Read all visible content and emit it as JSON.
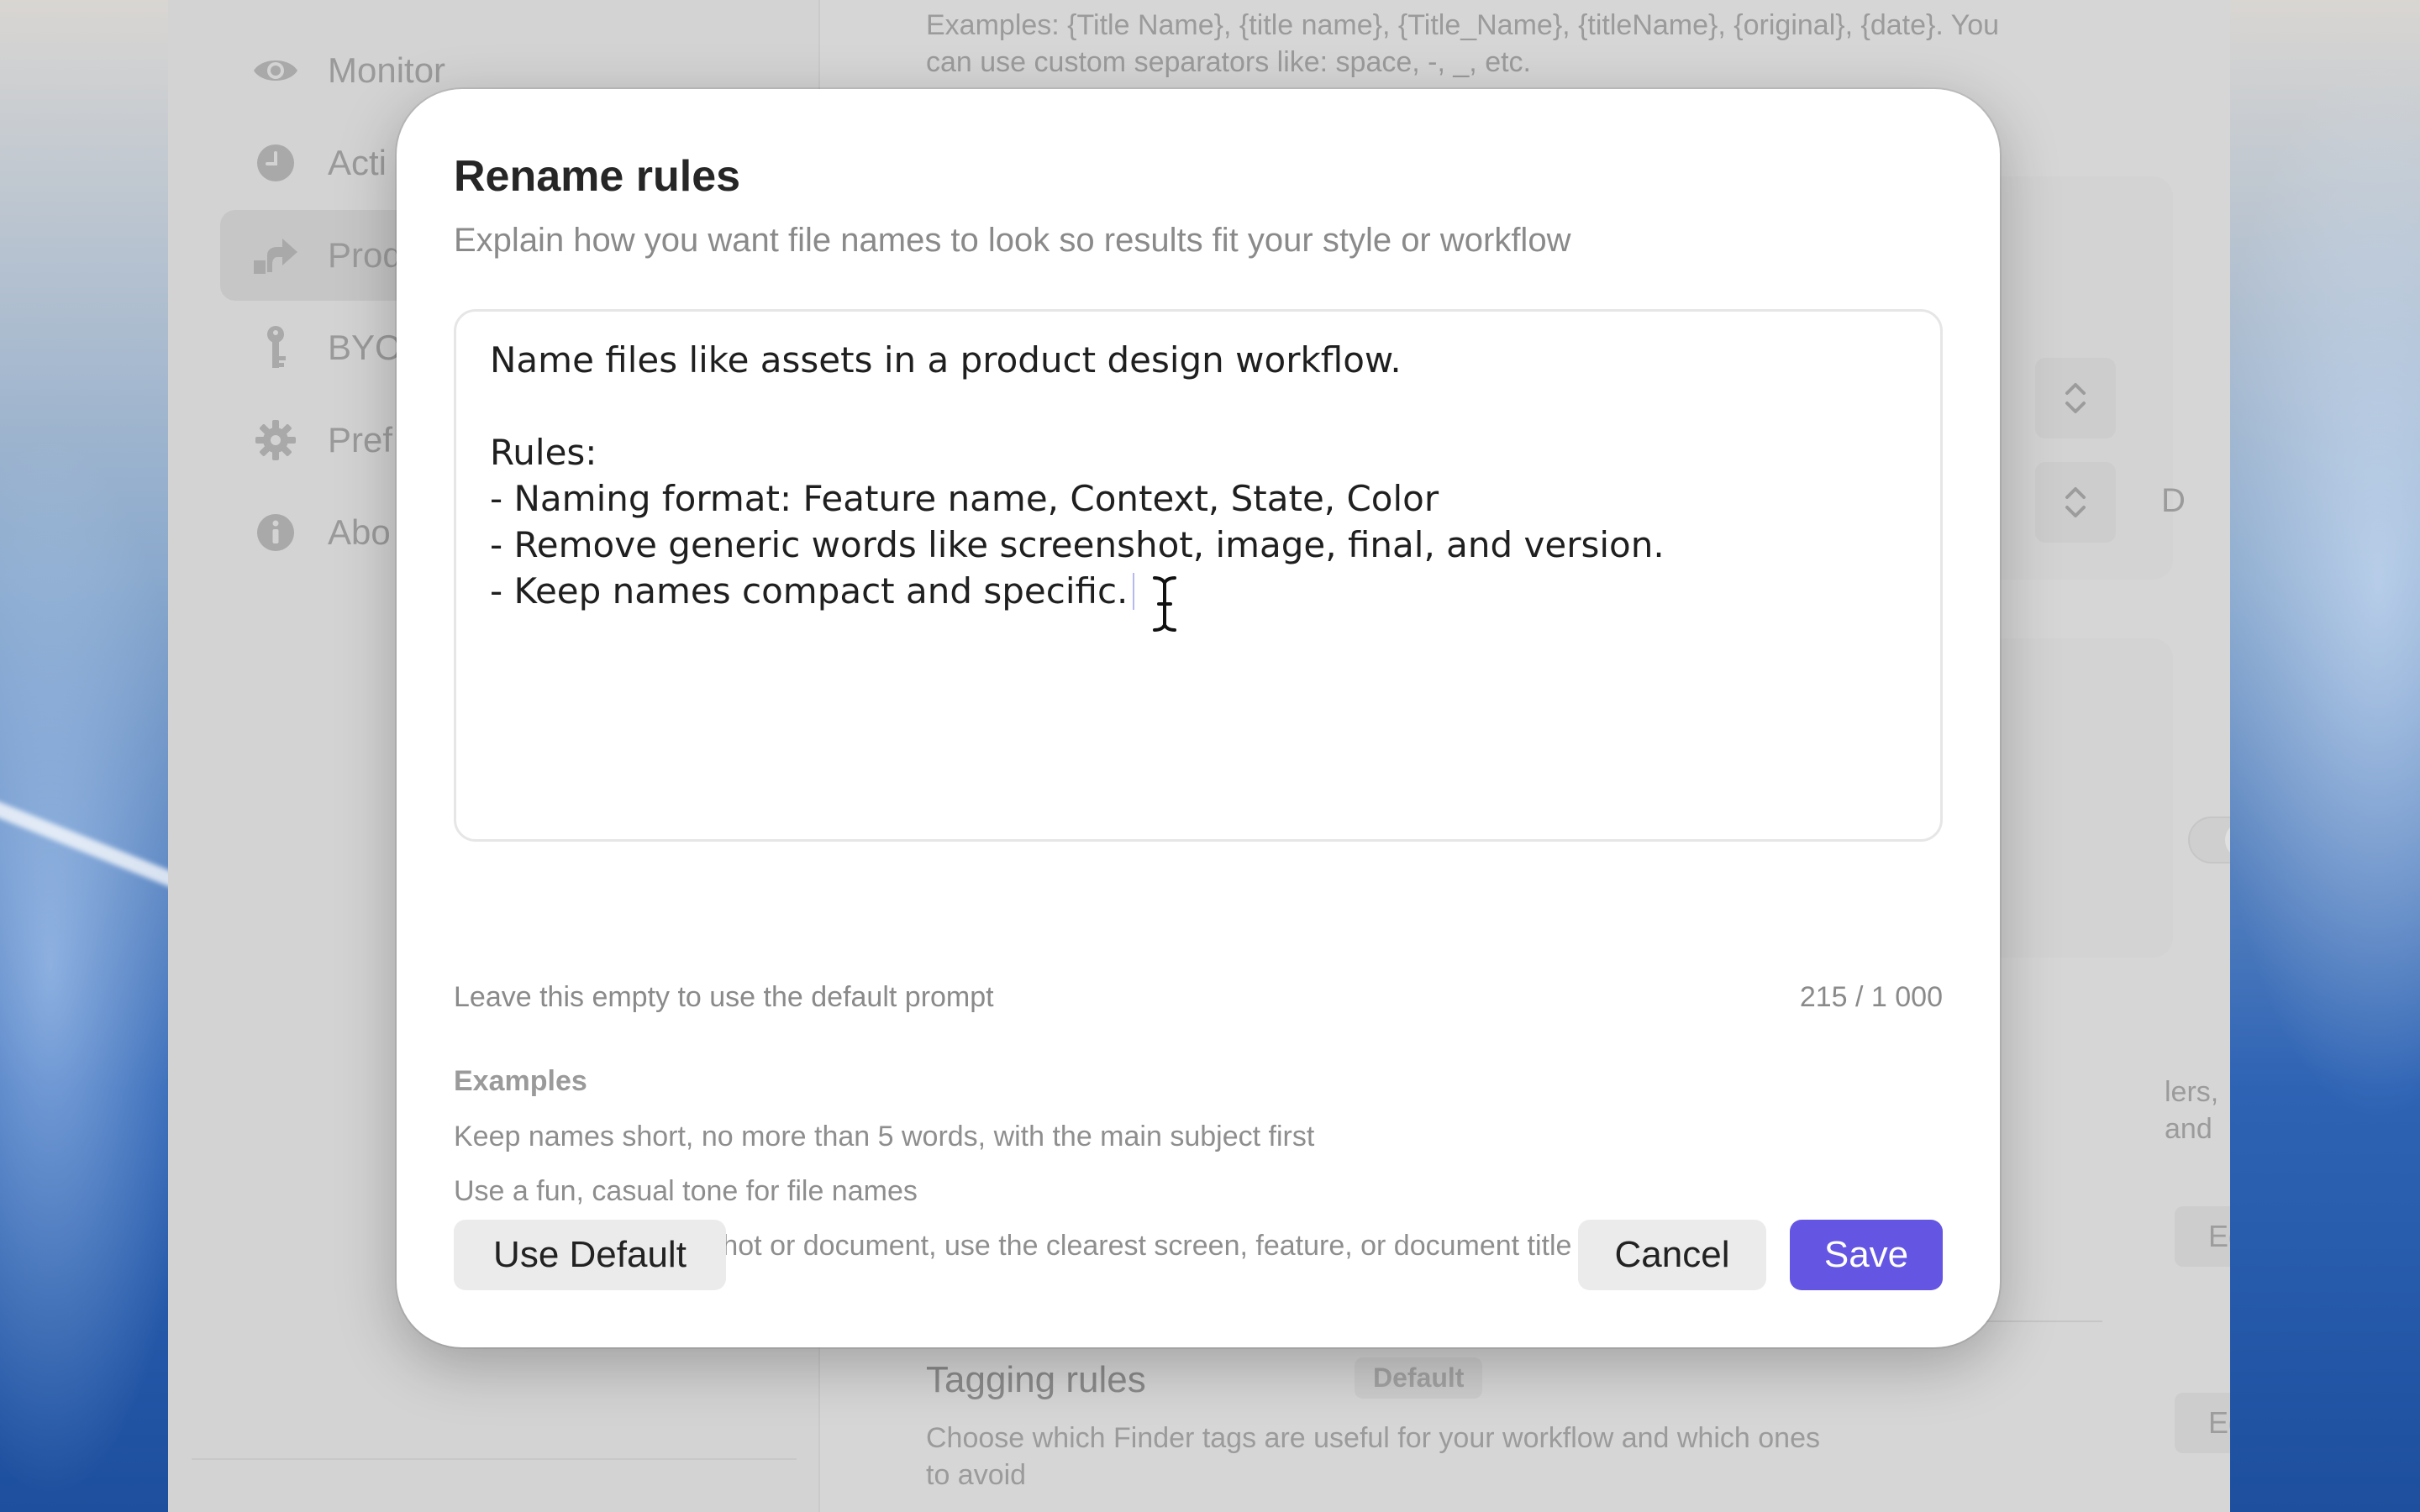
{
  "sidebar": {
    "items": [
      {
        "label": "Monitor",
        "icon": "eye-icon"
      },
      {
        "label": "Acti",
        "icon": "clock-icon"
      },
      {
        "label": "Prod",
        "icon": "share-arrow-icon"
      },
      {
        "label": "BYO",
        "icon": "key-icon"
      },
      {
        "label": "Pref",
        "icon": "gear-icon"
      },
      {
        "label": "Abo",
        "icon": "info-icon"
      }
    ],
    "selected_index": 2
  },
  "background": {
    "top_description_line1": "Examples: {Title Name}, {title name}, {Title_Name}, {titleName}, {original}, {date}. You",
    "top_description_line2": "can use custom separators like: space, -, _, etc.",
    "stepper_partial_text": "D",
    "right_partial_text": "lers, and",
    "edit_label_1": "Edit",
    "tagging_title": "Tagging rules",
    "tagging_badge": "Default",
    "tagging_edit_label": "Edit",
    "tagging_desc_line1": "Choose which Finder tags are useful for your workflow and which ones",
    "tagging_desc_line2": "to avoid"
  },
  "modal": {
    "title": "Rename rules",
    "subtitle": "Explain how you want file names to look so results fit your style or workflow",
    "editor_text": "Name files like assets in a product design workflow.\n\nRules:\n- Naming format: Feature name, Context, State, Color\n- Remove generic words like screenshot, image, final, and version.\n- Keep names compact and specific.",
    "helper_text": "Leave this empty to use the default prompt",
    "char_count": "215 / 1 000",
    "examples_heading": "Examples",
    "examples": [
      "Keep names short, no more than 5 words, with the main subject first",
      "Use a fun, casual tone for file names",
      "If the file is a screenshot or document, use the clearest screen, feature, or document title"
    ],
    "buttons": {
      "use_default": "Use Default",
      "cancel": "Cancel",
      "save": "Save"
    }
  },
  "colors": {
    "accent": "#6455e3",
    "caret": "#b9b7f2"
  }
}
